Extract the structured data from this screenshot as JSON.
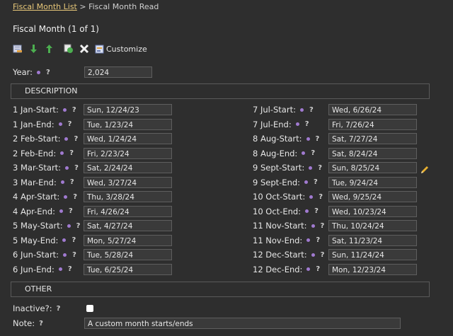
{
  "breadcrumb": {
    "link": "Fiscal Month List",
    "sep": ">",
    "current": "Fiscal Month Read"
  },
  "title": "Fiscal Month (1 of 1)",
  "toolbar": {
    "customize_label": "Customize"
  },
  "year": {
    "label": "Year:",
    "help": "?",
    "value": "2,024"
  },
  "sections": {
    "description": "DESCRIPTION",
    "other": "OTHER"
  },
  "months_left": [
    {
      "label": "1 Jan-Start:",
      "value": "Sun, 12/24/23"
    },
    {
      "label": "1 Jan-End:",
      "value": "Tue, 1/23/24"
    },
    {
      "label": "2 Feb-Start:",
      "value": "Wed, 1/24/24"
    },
    {
      "label": "2 Feb-End:",
      "value": "Fri, 2/23/24"
    },
    {
      "label": "3 Mar-Start:",
      "value": "Sat, 2/24/24"
    },
    {
      "label": "3 Mar-End:",
      "value": "Wed, 3/27/24"
    },
    {
      "label": "4 Apr-Start:",
      "value": "Thu, 3/28/24"
    },
    {
      "label": "4 Apr-End:",
      "value": "Fri, 4/26/24"
    },
    {
      "label": "5 May-Start:",
      "value": "Sat, 4/27/24"
    },
    {
      "label": "5 May-End:",
      "value": "Mon, 5/27/24"
    },
    {
      "label": "6 Jun-Start:",
      "value": "Tue, 5/28/24"
    },
    {
      "label": "6 Jun-End:",
      "value": "Tue, 6/25/24"
    }
  ],
  "months_right": [
    {
      "label": "7 Jul-Start:",
      "value": "Wed, 6/26/24"
    },
    {
      "label": "7 Jul-End:",
      "value": "Fri, 7/26/24"
    },
    {
      "label": "8 Aug-Start:",
      "value": "Sat, 7/27/24"
    },
    {
      "label": "8 Aug-End:",
      "value": "Sat, 8/24/24"
    },
    {
      "label": "9 Sept-Start:",
      "value": "Sun, 8/25/24"
    },
    {
      "label": "9 Sept-End:",
      "value": "Tue, 9/24/24"
    },
    {
      "label": "10 Oct-Start:",
      "value": "Wed, 9/25/24"
    },
    {
      "label": "10 Oct-End:",
      "value": "Wed, 10/23/24"
    },
    {
      "label": "11 Nov-Start:",
      "value": "Thu, 10/24/24"
    },
    {
      "label": "11 Nov-End:",
      "value": "Sat, 11/23/24"
    },
    {
      "label": "12 Dec-Start:",
      "value": "Sun, 11/24/24"
    },
    {
      "label": "12 Dec-End:",
      "value": "Mon, 12/23/24"
    }
  ],
  "help": "?",
  "inactive": {
    "label": "Inactive?:",
    "checked": false
  },
  "note": {
    "label": "Note:",
    "value": "A custom month starts/ends"
  },
  "colors": {
    "accent": "#e8c879",
    "required_dot": "#a07ad0",
    "background": "#2e2e2e"
  }
}
